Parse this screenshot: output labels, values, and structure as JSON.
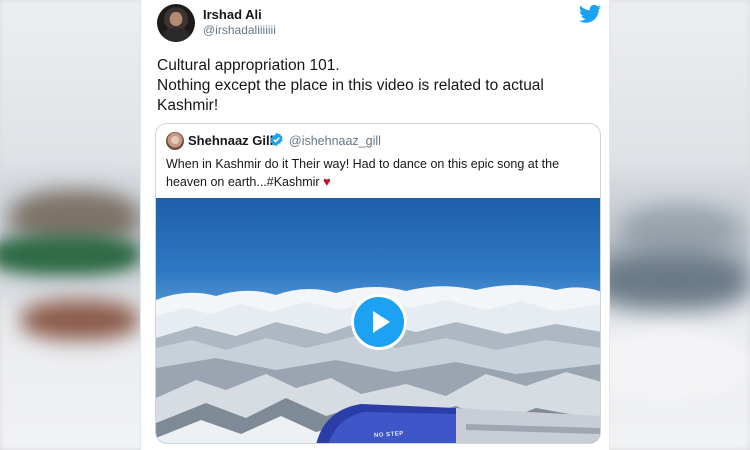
{
  "tweet": {
    "author_name": "Irshad Ali",
    "author_handle": "@irshadaliiiiiii",
    "text_lines": [
      "Cultural appropriation 101.",
      "Nothing except the place in this video is related to actual",
      "Kashmir!"
    ]
  },
  "quoted_tweet": {
    "author_name": "Shehnaaz Gill",
    "author_handle": "@ishehnaaz_gill",
    "text_line1": "When in Kashmir do it Their way! Had to dance on this epic song at the",
    "text_line2": "heaven on earth...#Kashmir ",
    "heart": "♥"
  },
  "video": {
    "engine_text": "NO STEP"
  },
  "colors": {
    "twitter_blue": "#1da1f2",
    "heart_red": "#c1121f",
    "engine_blue": "#2b3ea8"
  },
  "icons": [
    "twitter-bird-icon",
    "verified-badge-icon",
    "play-icon",
    "heart-icon"
  ]
}
